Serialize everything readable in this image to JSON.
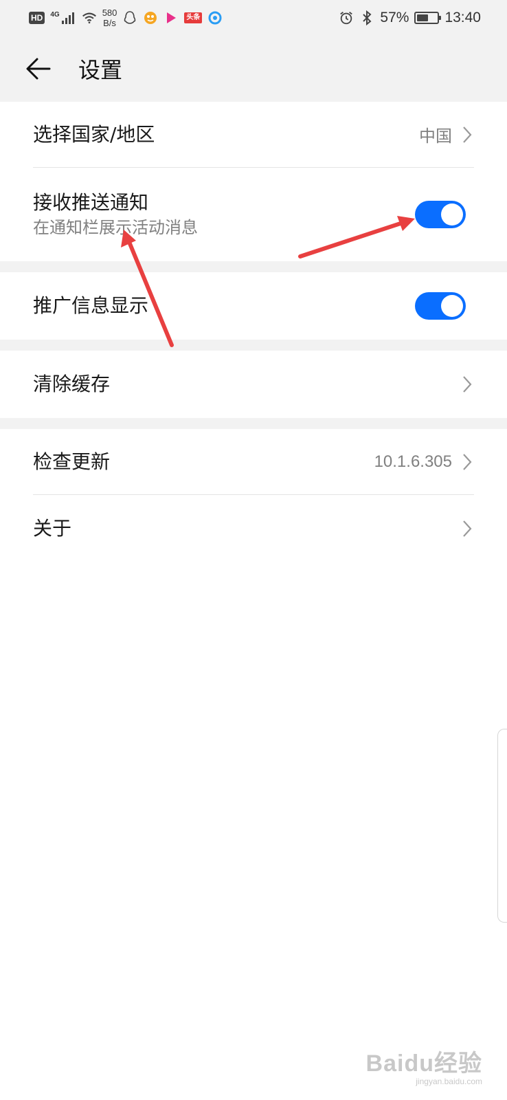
{
  "status_bar": {
    "hd_badge": "HD",
    "network_type": "4G",
    "speed_value": "580",
    "speed_unit": "B/s",
    "toutiao_label": "头条",
    "battery_percent": "57%",
    "battery_level": 0.57,
    "time": "13:40"
  },
  "header": {
    "title": "设置"
  },
  "settings": {
    "country": {
      "label": "选择国家/地区",
      "value": "中国"
    },
    "push": {
      "label": "接收推送通知",
      "subtitle": "在通知栏展示活动消息",
      "enabled": true
    },
    "promo": {
      "label": "推广信息显示",
      "enabled": true
    },
    "cache": {
      "label": "清除缓存"
    },
    "update": {
      "label": "检查更新",
      "value": "10.1.6.305"
    },
    "about": {
      "label": "关于"
    }
  },
  "colors": {
    "accent": "#0a6eff",
    "annotation_arrow": "#e84040",
    "section_background": "#f2f2f2"
  },
  "watermark": {
    "brand": "Baidu经验",
    "url": "jingyan.baidu.com"
  }
}
